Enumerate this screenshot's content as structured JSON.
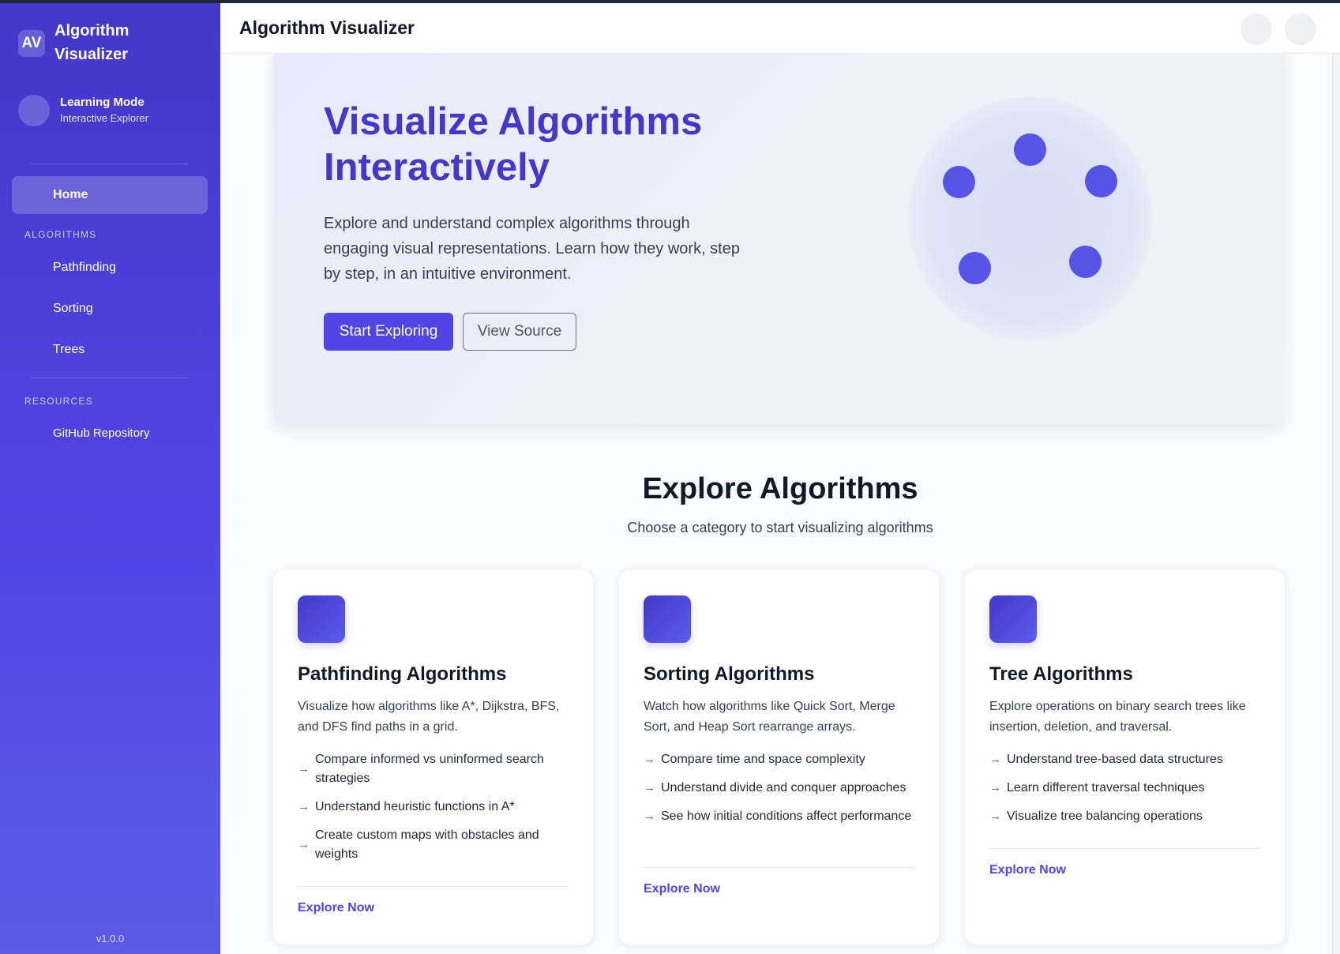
{
  "sidebar": {
    "badge": "AV",
    "brand": "Algorithm Visualizer",
    "profile": {
      "name": "Learning Mode",
      "subtitle": "Interactive Explorer"
    },
    "home": "Home",
    "algorithms_heading": "ALGORITHMS",
    "algorithms": [
      "Pathfinding",
      "Sorting",
      "Trees"
    ],
    "resources_heading": "RESOURCES",
    "resources": [
      "GitHub Repository"
    ],
    "version": "v1.0.0"
  },
  "header": {
    "title": "Algorithm Visualizer"
  },
  "hero": {
    "title": "Visualize Algorithms Interactively",
    "description": "Explore and understand complex algorithms through engaging visual representations. Learn how they work, step by step, in an intuitive environment.",
    "primary_button": "Start Exploring",
    "secondary_button": "View Source"
  },
  "explore": {
    "title": "Explore Algorithms",
    "subtitle": "Choose a category to start visualizing algorithms"
  },
  "cards": [
    {
      "title": "Pathfinding Algorithms",
      "description": "Visualize how algorithms like A*, Dijkstra, BFS, and DFS find paths in a grid.",
      "features": [
        "Compare informed vs uninformed search strategies",
        "Understand heuristic functions in A*",
        "Create custom maps with obstacles and weights"
      ],
      "link": "Explore Now"
    },
    {
      "title": "Sorting Algorithms",
      "description": "Watch how algorithms like Quick Sort, Merge Sort, and Heap Sort rearrange arrays.",
      "features": [
        "Compare time and space complexity",
        "Understand divide and conquer approaches",
        "See how initial conditions affect performance"
      ],
      "link": "Explore Now"
    },
    {
      "title": "Tree Algorithms",
      "description": "Explore operations on binary search trees like insertion, deletion, and traversal.",
      "features": [
        "Understand tree-based data structures",
        "Learn different traversal techniques",
        "Visualize tree balancing operations"
      ],
      "link": "Explore Now"
    }
  ],
  "colors": {
    "accent": "#4f46e5",
    "sidebar": "#4338ca"
  },
  "icons": {
    "feature_bullet": "arrow-right-icon"
  }
}
